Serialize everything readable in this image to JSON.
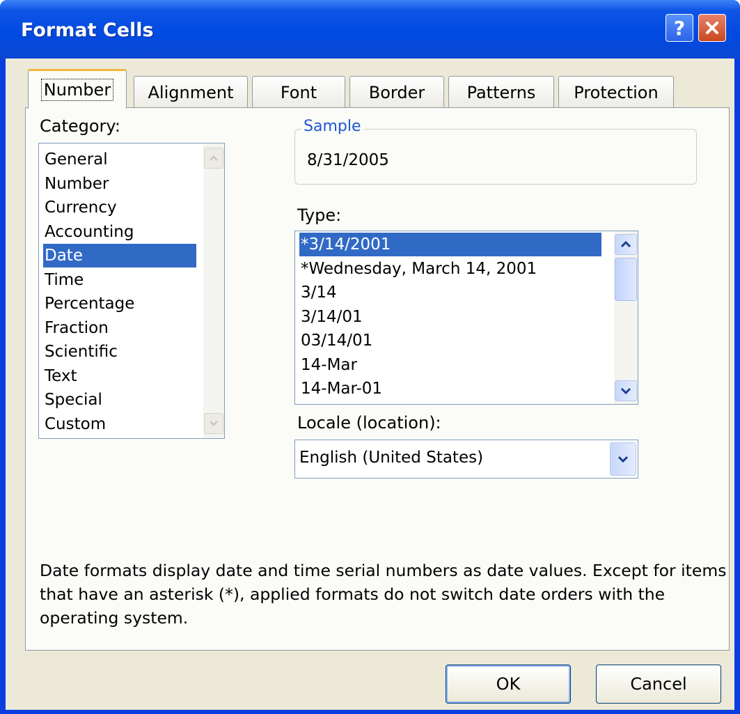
{
  "window": {
    "title": "Format Cells",
    "help_glyph": "?"
  },
  "tabs": [
    {
      "label": "Number",
      "active": true
    },
    {
      "label": "Alignment",
      "active": false
    },
    {
      "label": "Font",
      "active": false
    },
    {
      "label": "Border",
      "active": false
    },
    {
      "label": "Patterns",
      "active": false
    },
    {
      "label": "Protection",
      "active": false
    }
  ],
  "category": {
    "label": "Category:",
    "items": [
      "General",
      "Number",
      "Currency",
      "Accounting",
      "Date",
      "Time",
      "Percentage",
      "Fraction",
      "Scientific",
      "Text",
      "Special",
      "Custom"
    ],
    "selected": "Date"
  },
  "sample": {
    "legend": "Sample",
    "value": "8/31/2005"
  },
  "type": {
    "label": "Type:",
    "items": [
      "*3/14/2001",
      "*Wednesday, March 14, 2001",
      "3/14",
      "3/14/01",
      "03/14/01",
      "14-Mar",
      "14-Mar-01"
    ],
    "selected": "*3/14/2001"
  },
  "locale": {
    "label": "Locale (location):",
    "value": "English (United States)"
  },
  "description": "Date formats display date and time serial numbers as date values. Except for items that have an asterisk (*), applied formats do not switch date orders with the operating system.",
  "buttons": {
    "ok": "OK",
    "cancel": "Cancel"
  },
  "colors": {
    "titlebar": "#0049e0",
    "selection": "#316ac5",
    "active_tab_accent": "#f3b53a",
    "group_legend": "#1f57d6"
  },
  "icons": {
    "help": "help-icon",
    "close": "close-icon",
    "scroll_up": "chevron-up-icon",
    "scroll_down": "chevron-down-icon",
    "dropdown": "chevron-down-icon"
  }
}
